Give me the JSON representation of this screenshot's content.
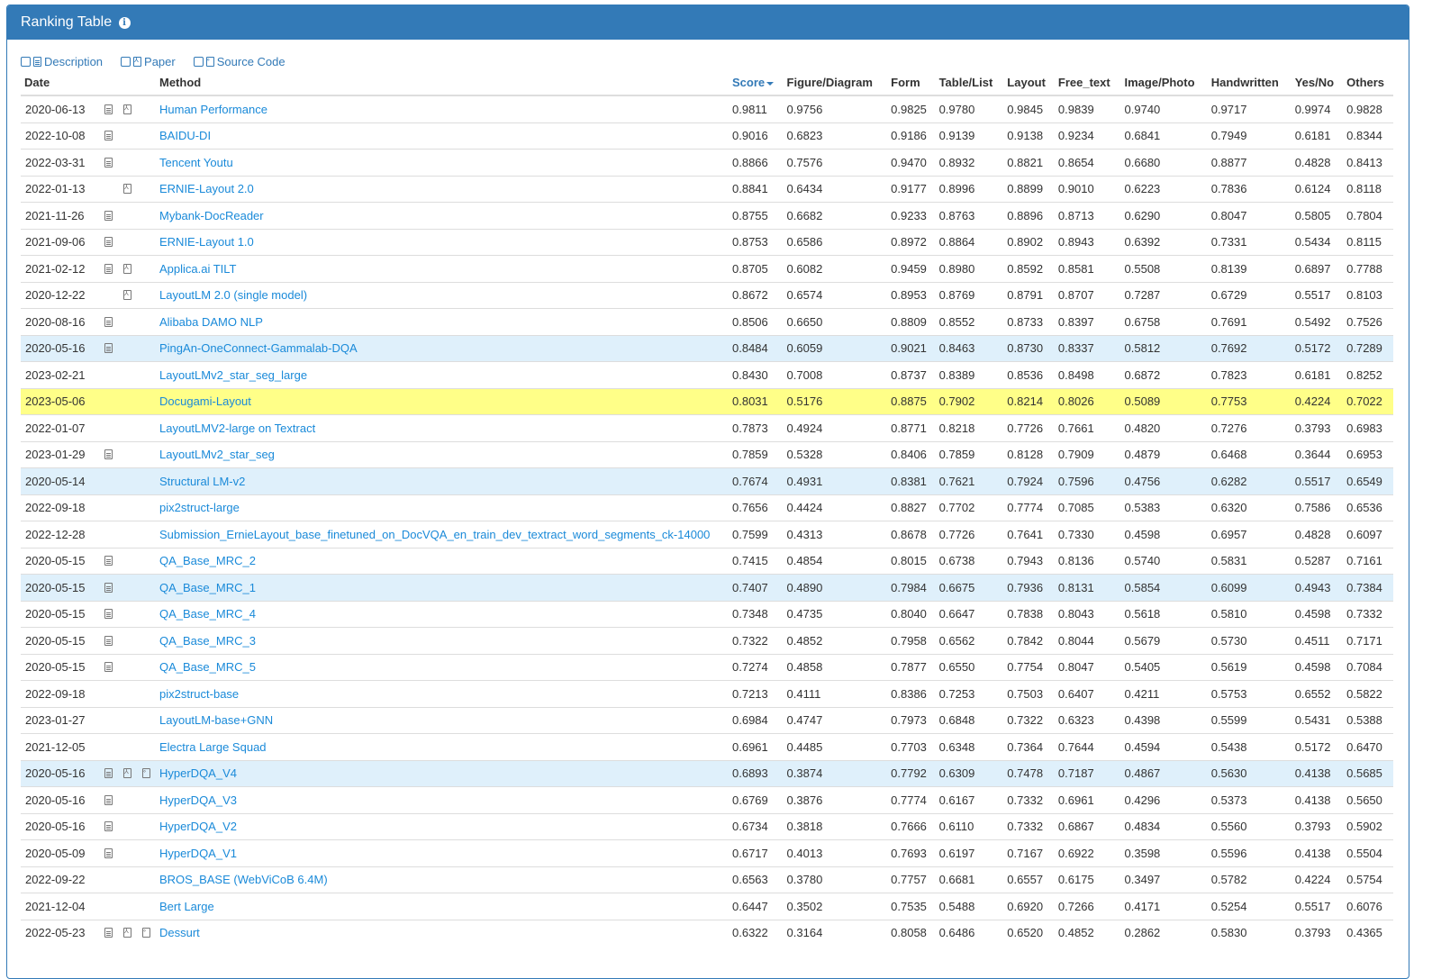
{
  "panel": {
    "title": "Ranking Table",
    "info_icon": "info-circle-icon"
  },
  "filters": [
    {
      "label": "Description",
      "icon": "description-doc-icon",
      "checked": false
    },
    {
      "label": "Paper",
      "icon": "pdf-icon",
      "checked": false
    },
    {
      "label": "Source Code",
      "icon": "code-file-icon",
      "checked": false
    }
  ],
  "colors": {
    "header": "#337ab7",
    "link": "#1a8ad9",
    "highlight_yellow": "#ffff88",
    "highlight_blue": "#dff0fb"
  },
  "table": {
    "columns": [
      "Date",
      "Method",
      "Score",
      "Figure/Diagram",
      "Form",
      "Table/List",
      "Layout",
      "Free_text",
      "Image/Photo",
      "Handwritten",
      "Yes/No",
      "Others"
    ],
    "sort_column": "Score",
    "rows": [
      {
        "date": "2020-06-13",
        "desc": true,
        "paper": true,
        "code": false,
        "method": "Human Performance",
        "hl": "",
        "v": [
          "0.9811",
          "0.9756",
          "0.9825",
          "0.9780",
          "0.9845",
          "0.9839",
          "0.9740",
          "0.9717",
          "0.9974",
          "0.9828"
        ]
      },
      {
        "date": "2022-10-08",
        "desc": true,
        "paper": false,
        "code": false,
        "method": "BAIDU-DI",
        "hl": "",
        "v": [
          "0.9016",
          "0.6823",
          "0.9186",
          "0.9139",
          "0.9138",
          "0.9234",
          "0.6841",
          "0.7949",
          "0.6181",
          "0.8344"
        ]
      },
      {
        "date": "2022-03-31",
        "desc": true,
        "paper": false,
        "code": false,
        "method": "Tencent Youtu",
        "hl": "",
        "v": [
          "0.8866",
          "0.7576",
          "0.9470",
          "0.8932",
          "0.8821",
          "0.8654",
          "0.6680",
          "0.8877",
          "0.4828",
          "0.8413"
        ]
      },
      {
        "date": "2022-01-13",
        "desc": false,
        "paper": true,
        "code": false,
        "method": "ERNIE-Layout 2.0",
        "hl": "",
        "v": [
          "0.8841",
          "0.6434",
          "0.9177",
          "0.8996",
          "0.8899",
          "0.9010",
          "0.6223",
          "0.7836",
          "0.6124",
          "0.8118"
        ]
      },
      {
        "date": "2021-11-26",
        "desc": true,
        "paper": false,
        "code": false,
        "method": "Mybank-DocReader",
        "hl": "",
        "v": [
          "0.8755",
          "0.6682",
          "0.9233",
          "0.8763",
          "0.8896",
          "0.8713",
          "0.6290",
          "0.8047",
          "0.5805",
          "0.7804"
        ]
      },
      {
        "date": "2021-09-06",
        "desc": true,
        "paper": false,
        "code": false,
        "method": "ERNIE-Layout 1.0",
        "hl": "",
        "v": [
          "0.8753",
          "0.6586",
          "0.8972",
          "0.8864",
          "0.8902",
          "0.8943",
          "0.6392",
          "0.7331",
          "0.5434",
          "0.8115"
        ]
      },
      {
        "date": "2021-02-12",
        "desc": true,
        "paper": true,
        "code": false,
        "method": "Applica.ai TILT",
        "hl": "",
        "v": [
          "0.8705",
          "0.6082",
          "0.9459",
          "0.8980",
          "0.8592",
          "0.8581",
          "0.5508",
          "0.8139",
          "0.6897",
          "0.7788"
        ]
      },
      {
        "date": "2020-12-22",
        "desc": false,
        "paper": true,
        "code": false,
        "method": "LayoutLM 2.0 (single model)",
        "hl": "",
        "v": [
          "0.8672",
          "0.6574",
          "0.8953",
          "0.8769",
          "0.8791",
          "0.8707",
          "0.7287",
          "0.6729",
          "0.5517",
          "0.8103"
        ]
      },
      {
        "date": "2020-08-16",
        "desc": true,
        "paper": false,
        "code": false,
        "method": "Alibaba DAMO NLP",
        "hl": "",
        "v": [
          "0.8506",
          "0.6650",
          "0.8809",
          "0.8552",
          "0.8733",
          "0.8397",
          "0.6758",
          "0.7691",
          "0.5492",
          "0.7526"
        ]
      },
      {
        "date": "2020-05-16",
        "desc": true,
        "paper": false,
        "code": false,
        "method": "PingAn-OneConnect-Gammalab-DQA",
        "hl": "blue",
        "v": [
          "0.8484",
          "0.6059",
          "0.9021",
          "0.8463",
          "0.8730",
          "0.8337",
          "0.5812",
          "0.7692",
          "0.5172",
          "0.7289"
        ]
      },
      {
        "date": "2023-02-21",
        "desc": false,
        "paper": false,
        "code": false,
        "method": "LayoutLMv2_star_seg_large",
        "hl": "",
        "v": [
          "0.8430",
          "0.7008",
          "0.8737",
          "0.8389",
          "0.8536",
          "0.8498",
          "0.6872",
          "0.7823",
          "0.6181",
          "0.8252"
        ]
      },
      {
        "date": "2023-05-06",
        "desc": false,
        "paper": false,
        "code": false,
        "method": "Docugami-Layout",
        "hl": "yellow",
        "v": [
          "0.8031",
          "0.5176",
          "0.8875",
          "0.7902",
          "0.8214",
          "0.8026",
          "0.5089",
          "0.7753",
          "0.4224",
          "0.7022"
        ]
      },
      {
        "date": "2022-01-07",
        "desc": false,
        "paper": false,
        "code": false,
        "method": "LayoutLMV2-large on Textract",
        "hl": "",
        "v": [
          "0.7873",
          "0.4924",
          "0.8771",
          "0.8218",
          "0.7726",
          "0.7661",
          "0.4820",
          "0.7276",
          "0.3793",
          "0.6983"
        ]
      },
      {
        "date": "2023-01-29",
        "desc": true,
        "paper": false,
        "code": false,
        "method": "LayoutLMv2_star_seg",
        "hl": "",
        "v": [
          "0.7859",
          "0.5328",
          "0.8406",
          "0.7859",
          "0.8128",
          "0.7909",
          "0.4879",
          "0.6468",
          "0.3644",
          "0.6953"
        ]
      },
      {
        "date": "2020-05-14",
        "desc": false,
        "paper": false,
        "code": false,
        "method": "Structural LM-v2",
        "hl": "blue",
        "v": [
          "0.7674",
          "0.4931",
          "0.8381",
          "0.7621",
          "0.7924",
          "0.7596",
          "0.4756",
          "0.6282",
          "0.5517",
          "0.6549"
        ]
      },
      {
        "date": "2022-09-18",
        "desc": false,
        "paper": false,
        "code": false,
        "method": "pix2struct-large",
        "hl": "",
        "v": [
          "0.7656",
          "0.4424",
          "0.8827",
          "0.7702",
          "0.7774",
          "0.7085",
          "0.5383",
          "0.6320",
          "0.7586",
          "0.6536"
        ]
      },
      {
        "date": "2022-12-28",
        "desc": false,
        "paper": false,
        "code": false,
        "method": "Submission_ErnieLayout_base_finetuned_on_DocVQA_en_train_dev_textract_word_segments_ck-14000",
        "hl": "",
        "v": [
          "0.7599",
          "0.4313",
          "0.8678",
          "0.7726",
          "0.7641",
          "0.7330",
          "0.4598",
          "0.6957",
          "0.4828",
          "0.6097"
        ]
      },
      {
        "date": "2020-05-15",
        "desc": true,
        "paper": false,
        "code": false,
        "method": "QA_Base_MRC_2",
        "hl": "",
        "v": [
          "0.7415",
          "0.4854",
          "0.8015",
          "0.6738",
          "0.7943",
          "0.8136",
          "0.5740",
          "0.5831",
          "0.5287",
          "0.7161"
        ]
      },
      {
        "date": "2020-05-15",
        "desc": true,
        "paper": false,
        "code": false,
        "method": "QA_Base_MRC_1",
        "hl": "blue",
        "v": [
          "0.7407",
          "0.4890",
          "0.7984",
          "0.6675",
          "0.7936",
          "0.8131",
          "0.5854",
          "0.6099",
          "0.4943",
          "0.7384"
        ]
      },
      {
        "date": "2020-05-15",
        "desc": true,
        "paper": false,
        "code": false,
        "method": "QA_Base_MRC_4",
        "hl": "",
        "v": [
          "0.7348",
          "0.4735",
          "0.8040",
          "0.6647",
          "0.7838",
          "0.8043",
          "0.5618",
          "0.5810",
          "0.4598",
          "0.7332"
        ]
      },
      {
        "date": "2020-05-15",
        "desc": true,
        "paper": false,
        "code": false,
        "method": "QA_Base_MRC_3",
        "hl": "",
        "v": [
          "0.7322",
          "0.4852",
          "0.7958",
          "0.6562",
          "0.7842",
          "0.8044",
          "0.5679",
          "0.5730",
          "0.4511",
          "0.7171"
        ]
      },
      {
        "date": "2020-05-15",
        "desc": true,
        "paper": false,
        "code": false,
        "method": "QA_Base_MRC_5",
        "hl": "",
        "v": [
          "0.7274",
          "0.4858",
          "0.7877",
          "0.6550",
          "0.7754",
          "0.8047",
          "0.5405",
          "0.5619",
          "0.4598",
          "0.7084"
        ]
      },
      {
        "date": "2022-09-18",
        "desc": false,
        "paper": false,
        "code": false,
        "method": "pix2struct-base",
        "hl": "",
        "v": [
          "0.7213",
          "0.4111",
          "0.8386",
          "0.7253",
          "0.7503",
          "0.6407",
          "0.4211",
          "0.5753",
          "0.6552",
          "0.5822"
        ]
      },
      {
        "date": "2023-01-27",
        "desc": false,
        "paper": false,
        "code": false,
        "method": "LayoutLM-base+GNN",
        "hl": "",
        "v": [
          "0.6984",
          "0.4747",
          "0.7973",
          "0.6848",
          "0.7322",
          "0.6323",
          "0.4398",
          "0.5599",
          "0.5431",
          "0.5388"
        ]
      },
      {
        "date": "2021-12-05",
        "desc": false,
        "paper": false,
        "code": false,
        "method": "Electra Large Squad",
        "hl": "",
        "v": [
          "0.6961",
          "0.4485",
          "0.7703",
          "0.6348",
          "0.7364",
          "0.7644",
          "0.4594",
          "0.5438",
          "0.5172",
          "0.6470"
        ]
      },
      {
        "date": "2020-05-16",
        "desc": true,
        "paper": true,
        "code": true,
        "method": "HyperDQA_V4",
        "hl": "blue",
        "v": [
          "0.6893",
          "0.3874",
          "0.7792",
          "0.6309",
          "0.7478",
          "0.7187",
          "0.4867",
          "0.5630",
          "0.4138",
          "0.5685"
        ]
      },
      {
        "date": "2020-05-16",
        "desc": true,
        "paper": false,
        "code": false,
        "method": "HyperDQA_V3",
        "hl": "",
        "v": [
          "0.6769",
          "0.3876",
          "0.7774",
          "0.6167",
          "0.7332",
          "0.6961",
          "0.4296",
          "0.5373",
          "0.4138",
          "0.5650"
        ]
      },
      {
        "date": "2020-05-16",
        "desc": true,
        "paper": false,
        "code": false,
        "method": "HyperDQA_V2",
        "hl": "",
        "v": [
          "0.6734",
          "0.3818",
          "0.7666",
          "0.6110",
          "0.7332",
          "0.6867",
          "0.4834",
          "0.5560",
          "0.3793",
          "0.5902"
        ]
      },
      {
        "date": "2020-05-09",
        "desc": true,
        "paper": false,
        "code": false,
        "method": "HyperDQA_V1",
        "hl": "",
        "v": [
          "0.6717",
          "0.4013",
          "0.7693",
          "0.6197",
          "0.7167",
          "0.6922",
          "0.3598",
          "0.5596",
          "0.4138",
          "0.5504"
        ]
      },
      {
        "date": "2022-09-22",
        "desc": false,
        "paper": false,
        "code": false,
        "method": "BROS_BASE (WebViCoB 6.4M)",
        "hl": "",
        "v": [
          "0.6563",
          "0.3780",
          "0.7757",
          "0.6681",
          "0.6557",
          "0.6175",
          "0.3497",
          "0.5782",
          "0.4224",
          "0.5754"
        ]
      },
      {
        "date": "2021-12-04",
        "desc": false,
        "paper": false,
        "code": false,
        "method": "Bert Large",
        "hl": "",
        "v": [
          "0.6447",
          "0.3502",
          "0.7535",
          "0.5488",
          "0.6920",
          "0.7266",
          "0.4171",
          "0.5254",
          "0.5517",
          "0.6076"
        ]
      },
      {
        "date": "2022-05-23",
        "desc": true,
        "paper": true,
        "code": true,
        "method": "Dessurt",
        "hl": "",
        "v": [
          "0.6322",
          "0.3164",
          "0.8058",
          "0.6486",
          "0.6520",
          "0.4852",
          "0.2862",
          "0.5830",
          "0.3793",
          "0.4365"
        ]
      }
    ]
  }
}
